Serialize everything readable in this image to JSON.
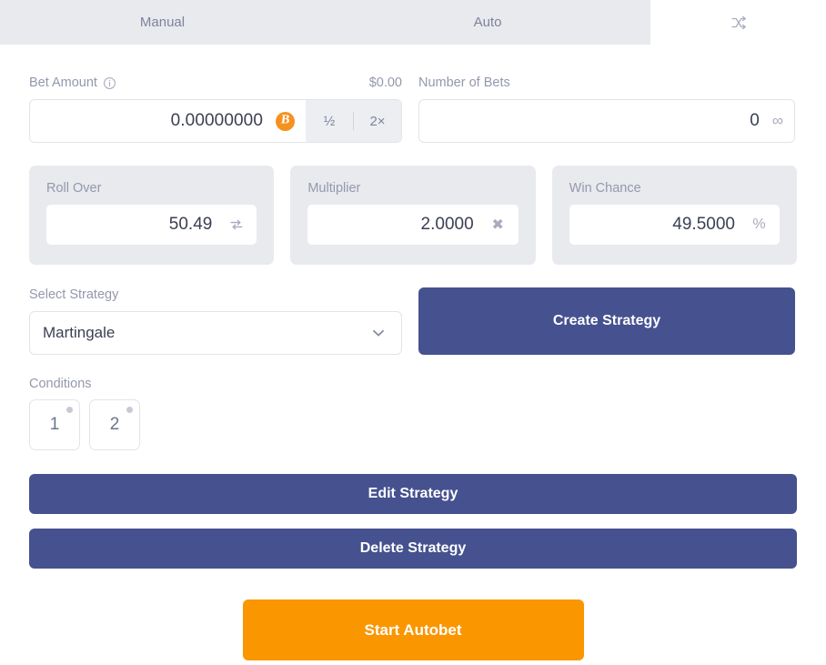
{
  "tabs": [
    {
      "id": "manual",
      "label": "Manual",
      "active": false
    },
    {
      "id": "auto",
      "label": "Auto",
      "active": false
    },
    {
      "id": "shuffle",
      "label": "",
      "icon": "shuffle-icon",
      "active": true
    }
  ],
  "bet_amount": {
    "label": "Bet Amount",
    "info_icon": "info-icon",
    "fiat_value": "$0.00",
    "value": "0.00000000",
    "currency_icon": "bitcoin-icon",
    "half_label": "½",
    "double_label": "2×"
  },
  "number_of_bets": {
    "label": "Number of Bets",
    "value": "0",
    "suffix_icon": "infinity-icon",
    "suffix_glyph": "∞"
  },
  "stats": [
    {
      "label": "Roll Over",
      "value": "50.49",
      "icon": "swap-icon",
      "glyph": "⇄"
    },
    {
      "label": "Multiplier",
      "value": "2.0000",
      "icon": "multiply-icon",
      "glyph": "✖"
    },
    {
      "label": "Win Chance",
      "value": "49.5000",
      "icon": "percent-icon",
      "glyph": "%"
    }
  ],
  "strategy": {
    "select_label": "Select Strategy",
    "selected": "Martingale",
    "chevron_icon": "chevron-down-icon",
    "create_label": "Create Strategy",
    "edit_label": "Edit Strategy",
    "delete_label": "Delete Strategy"
  },
  "conditions": {
    "label": "Conditions",
    "items": [
      {
        "label": "1"
      },
      {
        "label": "2"
      }
    ]
  },
  "start": {
    "label": "Start Autobet"
  },
  "colors": {
    "tab_inactive_bg": "#e9eaee",
    "primary_button": "#45528f",
    "start_button": "#fa9600",
    "bitcoin": "#f5921f",
    "muted_text": "#9498ad",
    "value_text": "#3b3f52"
  }
}
